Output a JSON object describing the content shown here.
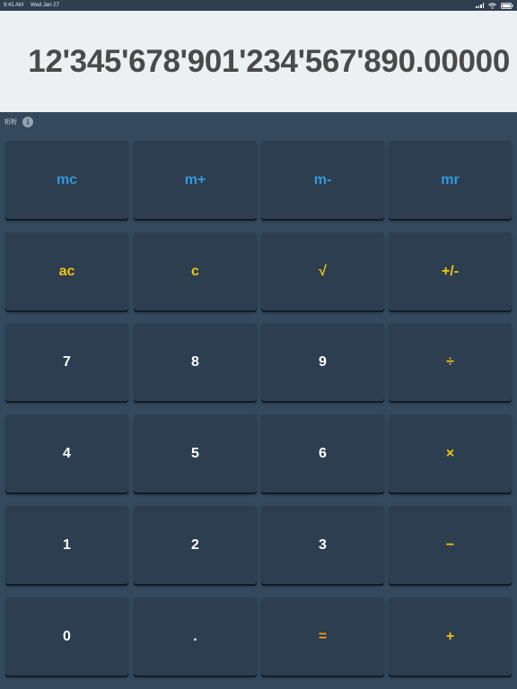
{
  "status_bar": {
    "time": "9:41 AM",
    "date": "Wed Jan 27"
  },
  "display": {
    "value": "12'345'678'901'234'567'890.00000"
  },
  "mode": {
    "label": "桁桁"
  },
  "keys": {
    "mc": "mc",
    "m_plus": "m+",
    "m_minus": "m-",
    "mr": "mr",
    "ac": "ac",
    "c": "c",
    "sqrt": "√",
    "plus_minus": "+/-",
    "seven": "7",
    "eight": "8",
    "nine": "9",
    "divide": "÷",
    "four": "4",
    "five": "5",
    "six": "6",
    "multiply": "×",
    "one": "1",
    "two": "2",
    "three": "3",
    "minus": "−",
    "zero": "0",
    "decimal": ".",
    "equals": "=",
    "plus": "+"
  },
  "icons": {
    "info": "info-icon",
    "signal": "signal-icon",
    "wifi": "wifi-icon",
    "battery": "battery-icon"
  },
  "colors": {
    "background": "#34495e",
    "key": "#2c3e50",
    "display": "#ecf0f1",
    "memory_keys": "#3498db",
    "function_keys": "#f1c40f",
    "equals_key": "#f39c12",
    "digits": "#ffffff"
  }
}
